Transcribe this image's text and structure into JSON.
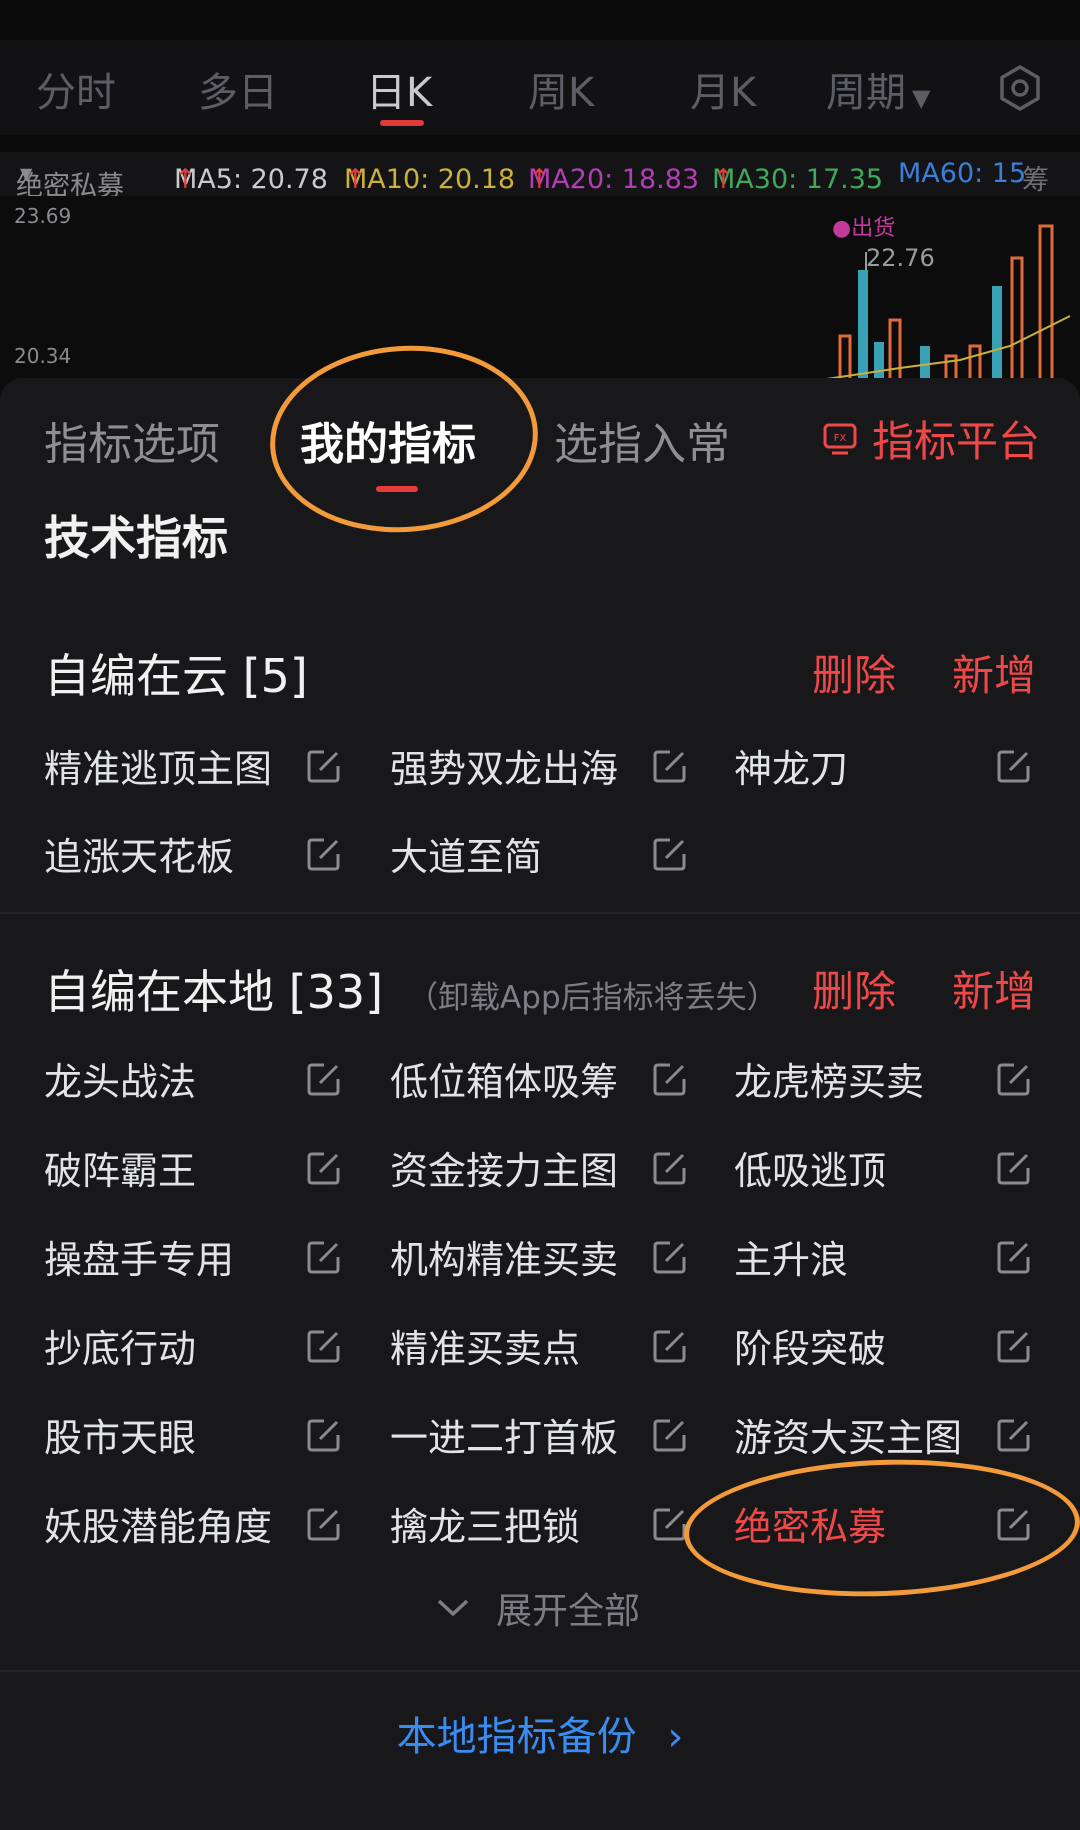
{
  "period_tabs": [
    "分时",
    "多日",
    "日K",
    "周K",
    "月K",
    "周期"
  ],
  "active_period": "日K",
  "ma_legend": {
    "indicator": "绝密私募",
    "ma5": "MA5: 20.78",
    "ma10": "MA10: 20.18",
    "ma20": "MA20: 18.83",
    "ma30": "MA30: 17.35",
    "ma60": "MA60: 15",
    "extra": "筹"
  },
  "chart": {
    "high": "23.69",
    "low": "20.34",
    "marker": "出货",
    "peak": "22.76"
  },
  "sheet": {
    "tabs": [
      "指标选项",
      "我的指标",
      "选指入常"
    ],
    "active_tab": "我的指标",
    "platform_label": "指标平台",
    "section_title": "技术指标",
    "cloud": {
      "title": "自编在云 [5]",
      "delete": "删除",
      "add": "新增",
      "items": [
        "精准逃顶主图",
        "强势双龙出海",
        "神龙刀",
        "追涨天花板",
        "大道至简"
      ]
    },
    "local": {
      "title": "自编在本地 [33]",
      "note": "（卸载App后指标将丢失）",
      "delete": "删除",
      "add": "新增",
      "items": [
        "龙头战法",
        "低位箱体吸筹",
        "龙虎榜买卖",
        "破阵霸王",
        "资金接力主图",
        "低吸逃顶",
        "操盘手专用",
        "机构精准买卖",
        "主升浪",
        "抄底行动",
        "精准买卖点",
        "阶段突破",
        "股市天眼",
        "一进二打首板",
        "游资大买主图",
        "妖股潜能角度",
        "擒龙三把锁",
        "绝密私募"
      ]
    },
    "expand_all": "展开全部",
    "backup": "本地指标备份"
  },
  "colors": {
    "accent_red": "#f04848",
    "link_blue": "#3b8cf0",
    "highlight_orange": "#f39a3a"
  }
}
